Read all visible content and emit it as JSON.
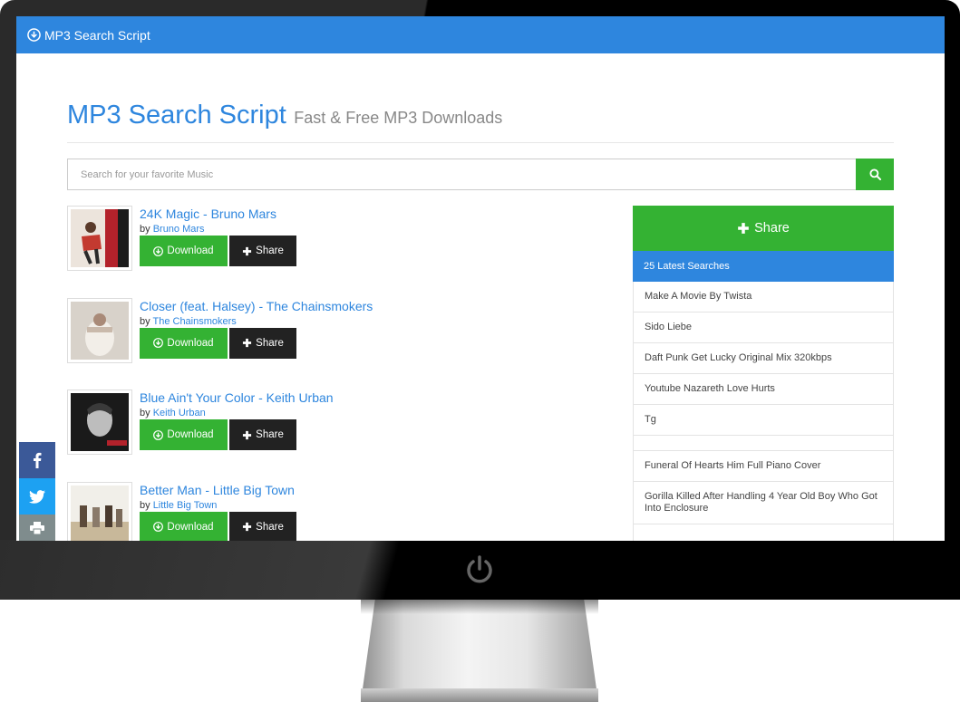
{
  "navbar": {
    "brand": "MP3 Search Script"
  },
  "header": {
    "title": "MP3 Search Script",
    "subtitle": "Fast & Free MP3 Downloads"
  },
  "search": {
    "placeholder": "Search for your favorite Music"
  },
  "buttons": {
    "download": "Download",
    "share": "Share"
  },
  "songs": [
    {
      "title": "24K Magic - Bruno Mars",
      "by": "by",
      "artist": "Bruno Mars"
    },
    {
      "title": "Closer (feat. Halsey) - The Chainsmokers",
      "by": "by",
      "artist": "The Chainsmokers"
    },
    {
      "title": "Blue Ain't Your Color - Keith Urban",
      "by": "by",
      "artist": "Keith Urban"
    },
    {
      "title": "Better Man - Little Big Town",
      "by": "by",
      "artist": "Little Big Town"
    }
  ],
  "sidebar": {
    "share_label": "Share",
    "latest_heading": "25 Latest Searches",
    "latest": [
      "Make A Movie By Twista",
      "Sido Liebe",
      "Daft Punk Get Lucky Original Mix 320kbps",
      "Youtube Nazareth Love Hurts",
      "Tg",
      "",
      "Funeral Of Hearts Him Full Piano Cover",
      "Gorilla Killed After Handling 4 Year Old Boy Who Got Into Enclosure"
    ]
  },
  "colors": {
    "primary": "#2e86de",
    "success": "#34b233",
    "dark": "#222222",
    "facebook": "#3b5998",
    "twitter": "#1da1f2",
    "print": "#7f8c8d"
  },
  "icons": {
    "brand": "download-circle-icon",
    "search": "search-icon",
    "download": "download-circle-icon",
    "share": "plus-icon",
    "power": "power-icon",
    "facebook": "facebook-icon",
    "twitter": "twitter-icon",
    "print": "print-icon"
  }
}
